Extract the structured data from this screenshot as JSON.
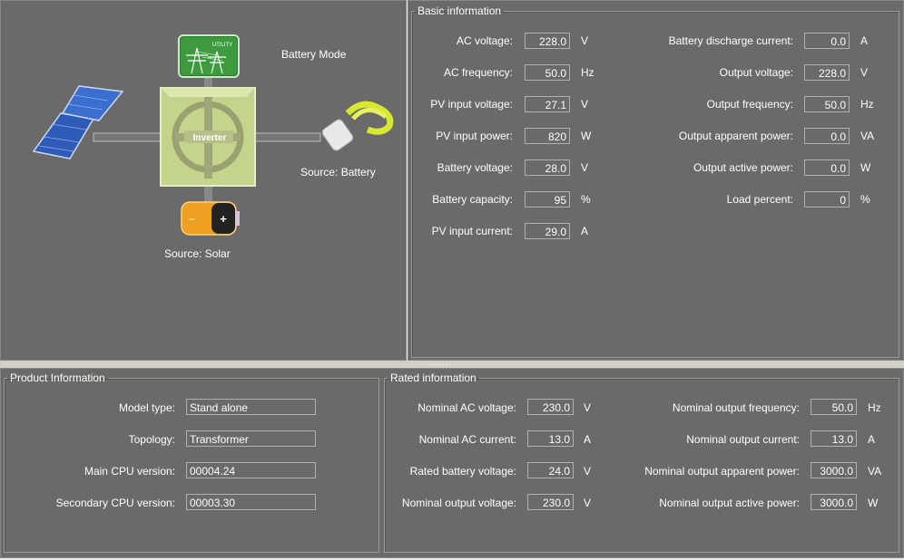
{
  "diagram": {
    "mode": "Battery Mode",
    "utility_label": "UTILITY",
    "inverter_label": "Inverter",
    "load_source": "Source:  Battery",
    "battery_source": "Source:  Solar"
  },
  "basic": {
    "title": "Basic information",
    "left": [
      {
        "label": "AC voltage:",
        "value": "228.0",
        "unit": "V"
      },
      {
        "label": "AC frequency:",
        "value": "50.0",
        "unit": "Hz"
      },
      {
        "label": "PV input voltage:",
        "value": "27.1",
        "unit": "V"
      },
      {
        "label": "PV input power:",
        "value": "820",
        "unit": "W"
      },
      {
        "label": "Battery voltage:",
        "value": "28.0",
        "unit": "V"
      },
      {
        "label": "Battery capacity:",
        "value": "95",
        "unit": "%"
      },
      {
        "label": "PV input current:",
        "value": "29.0",
        "unit": "A"
      }
    ],
    "right": [
      {
        "label": "Battery discharge current:",
        "value": "0.0",
        "unit": "A"
      },
      {
        "label": "Output voltage:",
        "value": "228.0",
        "unit": "V"
      },
      {
        "label": "Output frequency:",
        "value": "50.0",
        "unit": "Hz"
      },
      {
        "label": "Output apparent power:",
        "value": "0.0",
        "unit": "VA"
      },
      {
        "label": "Output active power:",
        "value": "0.0",
        "unit": "W"
      },
      {
        "label": "Load percent:",
        "value": "0",
        "unit": "%"
      }
    ]
  },
  "product": {
    "title": "Product Information",
    "rows": [
      {
        "label": "Model type:",
        "value": "Stand alone"
      },
      {
        "label": "Topology:",
        "value": "Transformer"
      },
      {
        "label": "Main CPU version:",
        "value": "00004.24"
      },
      {
        "label": "Secondary CPU version:",
        "value": "00003.30"
      }
    ]
  },
  "rated": {
    "title": "Rated information",
    "left": [
      {
        "label": "Nominal AC voltage:",
        "value": "230.0",
        "unit": "V"
      },
      {
        "label": "Nominal AC current:",
        "value": "13.0",
        "unit": "A"
      },
      {
        "label": "Rated battery voltage:",
        "value": "24.0",
        "unit": "V"
      },
      {
        "label": "Nominal output voltage:",
        "value": "230.0",
        "unit": "V"
      }
    ],
    "right": [
      {
        "label": "Nominal output frequency:",
        "value": "50.0",
        "unit": "Hz"
      },
      {
        "label": "Nominal output current:",
        "value": "13.0",
        "unit": "A"
      },
      {
        "label": "Nominal output apparent power:",
        "value": "3000.0",
        "unit": "VA"
      },
      {
        "label": "Nominal output active power:",
        "value": "3000.0",
        "unit": "W"
      }
    ]
  },
  "splitter_dots": "........",
  "colors": {
    "panel": "#6a6a6a",
    "inverter": "#c4d48a",
    "battery_orange": "#f0a020",
    "utility_green": "#2d7a2d",
    "solar_blue": "#3a6fd0"
  },
  "icons": [
    "utility-grid-icon",
    "solar-panel-icon",
    "lightbulb-icon",
    "battery-icon",
    "inverter-icon"
  ]
}
